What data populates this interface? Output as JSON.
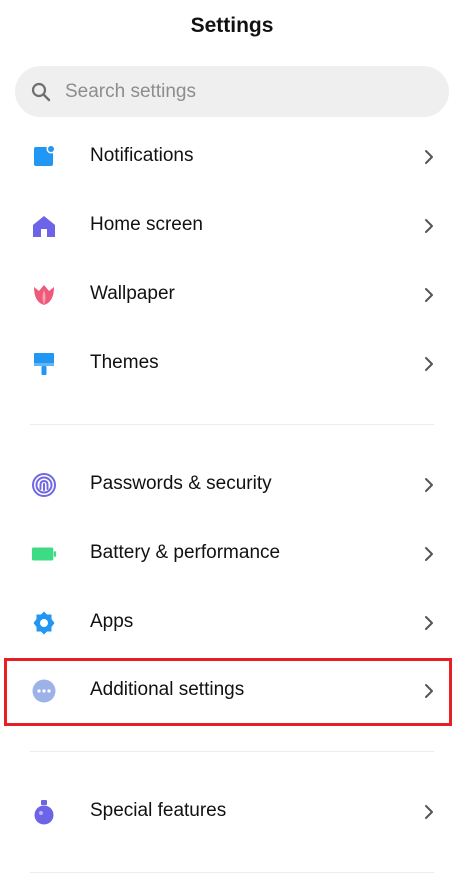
{
  "header": {
    "title": "Settings"
  },
  "search": {
    "placeholder": "Search settings",
    "icon": "search-icon"
  },
  "items": [
    {
      "label": "Notifications",
      "icon": "notifications-icon",
      "color": "#2196f3"
    },
    {
      "label": "Home screen",
      "icon": "home-icon",
      "color": "#6c63e6"
    },
    {
      "label": "Wallpaper",
      "icon": "wallpaper-tulip-icon",
      "color": "#ef5a7a"
    },
    {
      "label": "Themes",
      "icon": "themes-brush-icon",
      "color": "#2196f3"
    },
    {
      "label": "Passwords & security",
      "icon": "fingerprint-icon",
      "color": "#7068e0"
    },
    {
      "label": "Battery & performance",
      "icon": "battery-icon",
      "color": "#3ddc84"
    },
    {
      "label": "Apps",
      "icon": "apps-gear-icon",
      "color": "#2196f3"
    },
    {
      "label": "Additional settings",
      "icon": "more-dots-icon",
      "color": "#9db3e8"
    },
    {
      "label": "Special features",
      "icon": "special-features-flask-icon",
      "color": "#6c63e6"
    }
  ],
  "highlight": {
    "target": "Additional settings",
    "color": "#e81e25"
  }
}
